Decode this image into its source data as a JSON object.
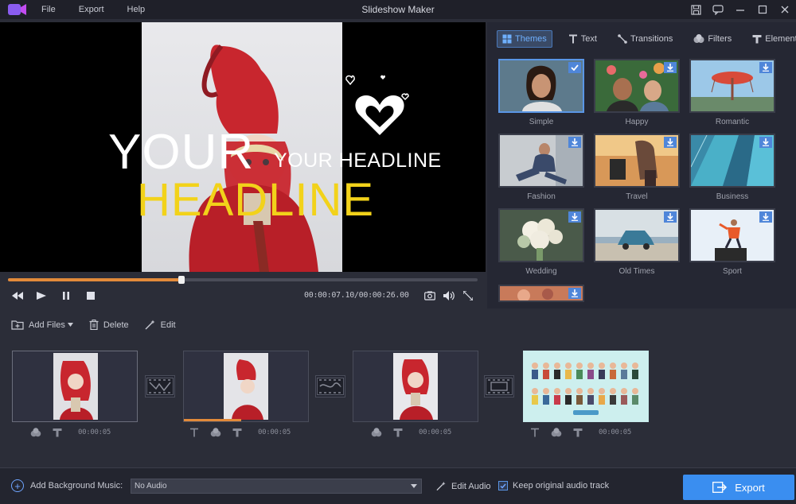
{
  "app": {
    "title": "Slideshow Maker",
    "menu": [
      "File",
      "Export",
      "Help"
    ],
    "accent": "#3a8ef0",
    "logo_icon": "video-logo-icon"
  },
  "preview": {
    "headline_white": "YOUR",
    "headline_yellow": "HEADLINE",
    "headline_small": "YOUR HEADLINE",
    "progress": 0.37,
    "timecode": "00:00:07.10/00:00:26.00"
  },
  "right_panel": {
    "tabs": [
      {
        "label": "Themes",
        "icon": "themes-icon",
        "active": true
      },
      {
        "label": "Text",
        "icon": "text-icon",
        "active": false
      },
      {
        "label": "Transitions",
        "icon": "transitions-icon",
        "active": false
      },
      {
        "label": "Filters",
        "icon": "filters-icon",
        "active": false
      },
      {
        "label": "Elements",
        "icon": "elements-icon",
        "active": false
      }
    ],
    "themes": [
      {
        "label": "Simple",
        "selected": true
      },
      {
        "label": "Happy",
        "selected": false
      },
      {
        "label": "Romantic",
        "selected": false
      },
      {
        "label": "Fashion",
        "selected": false
      },
      {
        "label": "Travel",
        "selected": false
      },
      {
        "label": "Business",
        "selected": false
      },
      {
        "label": "Wedding",
        "selected": false
      },
      {
        "label": "Old Times",
        "selected": false
      },
      {
        "label": "Sport",
        "selected": false
      },
      {
        "label": "",
        "selected": false
      }
    ]
  },
  "toolbar": {
    "add_files": "Add Files",
    "delete": "Delete",
    "edit": "Edit"
  },
  "timeline": {
    "clips": [
      {
        "duration": "00:00:05",
        "has_text": false
      },
      {
        "duration": "00:00:05",
        "has_text": true,
        "progress": 0.46
      },
      {
        "duration": "00:00:05",
        "has_text": false
      },
      {
        "duration": "00:00:05",
        "has_text": true
      }
    ]
  },
  "bottom": {
    "add_music": "Add Background Music:",
    "audio_value": "No Audio",
    "edit_audio": "Edit Audio",
    "keep_original": "Keep original audio track",
    "keep_checked": true,
    "export": "Export"
  }
}
